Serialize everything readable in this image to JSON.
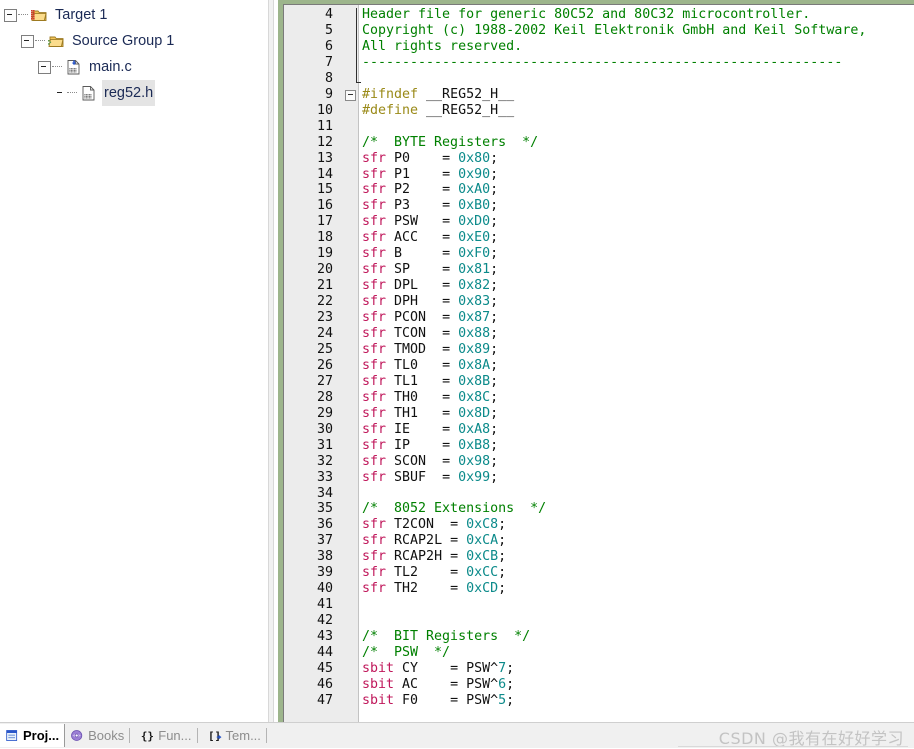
{
  "project_panel": {
    "name": "project-workspace",
    "tree": [
      {
        "label": "Target 1",
        "depth": 0,
        "icon": "target-folder-icon",
        "expander": "collapse",
        "selected": false
      },
      {
        "label": "Source Group 1",
        "depth": 1,
        "icon": "source-group-folder-icon",
        "expander": "collapse",
        "selected": false
      },
      {
        "label": "main.c",
        "depth": 2,
        "icon": "c-source-file-icon",
        "expander": "collapse",
        "selected": false
      },
      {
        "label": "reg52.h",
        "depth": 3,
        "icon": "header-file-icon",
        "expander": "none",
        "selected": true
      }
    ]
  },
  "editor": {
    "name": "source-editor",
    "filename": "reg52.h",
    "first_line": 4,
    "lines": [
      {
        "n": 4,
        "tokens": [
          {
            "t": "Header file for generic 80C52 and 80C32 microcontroller.",
            "c": "cm"
          }
        ],
        "bar": true
      },
      {
        "n": 5,
        "tokens": [
          {
            "t": "Copyright (c) 1988-2002 Keil Elektronik GmbH and Keil Software,",
            "c": "cm"
          }
        ],
        "bar": true
      },
      {
        "n": 6,
        "tokens": [
          {
            "t": "All rights reserved.",
            "c": "cm"
          }
        ],
        "bar": true
      },
      {
        "n": 7,
        "tokens": [
          {
            "t": "------------------------------------------------------------",
            "c": "cm"
          }
        ],
        "bar": true
      },
      {
        "n": 8,
        "tokens": [],
        "bar": true,
        "barfoot": true
      },
      {
        "n": 9,
        "tokens": [
          {
            "t": "#ifndef ",
            "c": "pp"
          },
          {
            "t": "__REG52_H__",
            "c": "pl"
          }
        ],
        "fold": true
      },
      {
        "n": 10,
        "tokens": [
          {
            "t": "#define ",
            "c": "pp"
          },
          {
            "t": "__REG52_H__",
            "c": "pl"
          }
        ]
      },
      {
        "n": 11,
        "tokens": []
      },
      {
        "n": 12,
        "tokens": [
          {
            "t": "/*  BYTE Registers  */",
            "c": "cm"
          }
        ]
      },
      {
        "n": 13,
        "tokens": [
          {
            "t": "sfr",
            "c": "kw"
          },
          {
            "t": " P0    = ",
            "c": "pl"
          },
          {
            "t": "0x80",
            "c": "num"
          },
          {
            "t": ";",
            "c": "pl"
          }
        ]
      },
      {
        "n": 14,
        "tokens": [
          {
            "t": "sfr",
            "c": "kw"
          },
          {
            "t": " P1    = ",
            "c": "pl"
          },
          {
            "t": "0x90",
            "c": "num"
          },
          {
            "t": ";",
            "c": "pl"
          }
        ]
      },
      {
        "n": 15,
        "tokens": [
          {
            "t": "sfr",
            "c": "kw"
          },
          {
            "t": " P2    = ",
            "c": "pl"
          },
          {
            "t": "0xA0",
            "c": "num"
          },
          {
            "t": ";",
            "c": "pl"
          }
        ]
      },
      {
        "n": 16,
        "tokens": [
          {
            "t": "sfr",
            "c": "kw"
          },
          {
            "t": " P3    = ",
            "c": "pl"
          },
          {
            "t": "0xB0",
            "c": "num"
          },
          {
            "t": ";",
            "c": "pl"
          }
        ]
      },
      {
        "n": 17,
        "tokens": [
          {
            "t": "sfr",
            "c": "kw"
          },
          {
            "t": " PSW   = ",
            "c": "pl"
          },
          {
            "t": "0xD0",
            "c": "num"
          },
          {
            "t": ";",
            "c": "pl"
          }
        ]
      },
      {
        "n": 18,
        "tokens": [
          {
            "t": "sfr",
            "c": "kw"
          },
          {
            "t": " ACC   = ",
            "c": "pl"
          },
          {
            "t": "0xE0",
            "c": "num"
          },
          {
            "t": ";",
            "c": "pl"
          }
        ]
      },
      {
        "n": 19,
        "tokens": [
          {
            "t": "sfr",
            "c": "kw"
          },
          {
            "t": " B     = ",
            "c": "pl"
          },
          {
            "t": "0xF0",
            "c": "num"
          },
          {
            "t": ";",
            "c": "pl"
          }
        ]
      },
      {
        "n": 20,
        "tokens": [
          {
            "t": "sfr",
            "c": "kw"
          },
          {
            "t": " SP    = ",
            "c": "pl"
          },
          {
            "t": "0x81",
            "c": "num"
          },
          {
            "t": ";",
            "c": "pl"
          }
        ]
      },
      {
        "n": 21,
        "tokens": [
          {
            "t": "sfr",
            "c": "kw"
          },
          {
            "t": " DPL   = ",
            "c": "pl"
          },
          {
            "t": "0x82",
            "c": "num"
          },
          {
            "t": ";",
            "c": "pl"
          }
        ]
      },
      {
        "n": 22,
        "tokens": [
          {
            "t": "sfr",
            "c": "kw"
          },
          {
            "t": " DPH   = ",
            "c": "pl"
          },
          {
            "t": "0x83",
            "c": "num"
          },
          {
            "t": ";",
            "c": "pl"
          }
        ]
      },
      {
        "n": 23,
        "tokens": [
          {
            "t": "sfr",
            "c": "kw"
          },
          {
            "t": " PCON  = ",
            "c": "pl"
          },
          {
            "t": "0x87",
            "c": "num"
          },
          {
            "t": ";",
            "c": "pl"
          }
        ]
      },
      {
        "n": 24,
        "tokens": [
          {
            "t": "sfr",
            "c": "kw"
          },
          {
            "t": " TCON  = ",
            "c": "pl"
          },
          {
            "t": "0x88",
            "c": "num"
          },
          {
            "t": ";",
            "c": "pl"
          }
        ]
      },
      {
        "n": 25,
        "tokens": [
          {
            "t": "sfr",
            "c": "kw"
          },
          {
            "t": " TMOD  = ",
            "c": "pl"
          },
          {
            "t": "0x89",
            "c": "num"
          },
          {
            "t": ";",
            "c": "pl"
          }
        ]
      },
      {
        "n": 26,
        "tokens": [
          {
            "t": "sfr",
            "c": "kw"
          },
          {
            "t": " TL0   = ",
            "c": "pl"
          },
          {
            "t": "0x8A",
            "c": "num"
          },
          {
            "t": ";",
            "c": "pl"
          }
        ]
      },
      {
        "n": 27,
        "tokens": [
          {
            "t": "sfr",
            "c": "kw"
          },
          {
            "t": " TL1   = ",
            "c": "pl"
          },
          {
            "t": "0x8B",
            "c": "num"
          },
          {
            "t": ";",
            "c": "pl"
          }
        ]
      },
      {
        "n": 28,
        "tokens": [
          {
            "t": "sfr",
            "c": "kw"
          },
          {
            "t": " TH0   = ",
            "c": "pl"
          },
          {
            "t": "0x8C",
            "c": "num"
          },
          {
            "t": ";",
            "c": "pl"
          }
        ]
      },
      {
        "n": 29,
        "tokens": [
          {
            "t": "sfr",
            "c": "kw"
          },
          {
            "t": " TH1   = ",
            "c": "pl"
          },
          {
            "t": "0x8D",
            "c": "num"
          },
          {
            "t": ";",
            "c": "pl"
          }
        ]
      },
      {
        "n": 30,
        "tokens": [
          {
            "t": "sfr",
            "c": "kw"
          },
          {
            "t": " IE    = ",
            "c": "pl"
          },
          {
            "t": "0xA8",
            "c": "num"
          },
          {
            "t": ";",
            "c": "pl"
          }
        ]
      },
      {
        "n": 31,
        "tokens": [
          {
            "t": "sfr",
            "c": "kw"
          },
          {
            "t": " IP    = ",
            "c": "pl"
          },
          {
            "t": "0xB8",
            "c": "num"
          },
          {
            "t": ";",
            "c": "pl"
          }
        ]
      },
      {
        "n": 32,
        "tokens": [
          {
            "t": "sfr",
            "c": "kw"
          },
          {
            "t": " SCON  = ",
            "c": "pl"
          },
          {
            "t": "0x98",
            "c": "num"
          },
          {
            "t": ";",
            "c": "pl"
          }
        ]
      },
      {
        "n": 33,
        "tokens": [
          {
            "t": "sfr",
            "c": "kw"
          },
          {
            "t": " SBUF  = ",
            "c": "pl"
          },
          {
            "t": "0x99",
            "c": "num"
          },
          {
            "t": ";",
            "c": "pl"
          }
        ]
      },
      {
        "n": 34,
        "tokens": []
      },
      {
        "n": 35,
        "tokens": [
          {
            "t": "/*  8052 Extensions  */",
            "c": "cm"
          }
        ]
      },
      {
        "n": 36,
        "tokens": [
          {
            "t": "sfr",
            "c": "kw"
          },
          {
            "t": " T2CON  = ",
            "c": "pl"
          },
          {
            "t": "0xC8",
            "c": "num"
          },
          {
            "t": ";",
            "c": "pl"
          }
        ]
      },
      {
        "n": 37,
        "tokens": [
          {
            "t": "sfr",
            "c": "kw"
          },
          {
            "t": " RCAP2L = ",
            "c": "pl"
          },
          {
            "t": "0xCA",
            "c": "num"
          },
          {
            "t": ";",
            "c": "pl"
          }
        ]
      },
      {
        "n": 38,
        "tokens": [
          {
            "t": "sfr",
            "c": "kw"
          },
          {
            "t": " RCAP2H = ",
            "c": "pl"
          },
          {
            "t": "0xCB",
            "c": "num"
          },
          {
            "t": ";",
            "c": "pl"
          }
        ]
      },
      {
        "n": 39,
        "tokens": [
          {
            "t": "sfr",
            "c": "kw"
          },
          {
            "t": " TL2    = ",
            "c": "pl"
          },
          {
            "t": "0xCC",
            "c": "num"
          },
          {
            "t": ";",
            "c": "pl"
          }
        ]
      },
      {
        "n": 40,
        "tokens": [
          {
            "t": "sfr",
            "c": "kw"
          },
          {
            "t": " TH2    = ",
            "c": "pl"
          },
          {
            "t": "0xCD",
            "c": "num"
          },
          {
            "t": ";",
            "c": "pl"
          }
        ]
      },
      {
        "n": 41,
        "tokens": []
      },
      {
        "n": 42,
        "tokens": []
      },
      {
        "n": 43,
        "tokens": [
          {
            "t": "/*  BIT Registers  */",
            "c": "cm"
          }
        ]
      },
      {
        "n": 44,
        "tokens": [
          {
            "t": "/*  PSW  */",
            "c": "cm"
          }
        ]
      },
      {
        "n": 45,
        "tokens": [
          {
            "t": "sbit",
            "c": "kw"
          },
          {
            "t": " CY    = PSW^",
            "c": "pl"
          },
          {
            "t": "7",
            "c": "num"
          },
          {
            "t": ";",
            "c": "pl"
          }
        ]
      },
      {
        "n": 46,
        "tokens": [
          {
            "t": "sbit",
            "c": "kw"
          },
          {
            "t": " AC    = PSW^",
            "c": "pl"
          },
          {
            "t": "6",
            "c": "num"
          },
          {
            "t": ";",
            "c": "pl"
          }
        ]
      },
      {
        "n": 47,
        "tokens": [
          {
            "t": "sbit",
            "c": "kw"
          },
          {
            "t": " F0    = PSW^",
            "c": "pl"
          },
          {
            "t": "5",
            "c": "num"
          },
          {
            "t": ";",
            "c": "pl"
          }
        ]
      }
    ]
  },
  "bottom_bar": {
    "name": "view-tab-bar",
    "tabs": [
      {
        "label": "Proj...",
        "icon": "project-window-icon",
        "active": true
      },
      {
        "label": "Books",
        "icon": "books-window-icon",
        "active": false
      },
      {
        "label": "Fun...",
        "icon": "functions-brace-icon",
        "active": false
      },
      {
        "label": "Tem...",
        "icon": "templates-icon",
        "active": false
      }
    ],
    "watermark": "CSDN @我有在好好学习"
  },
  "colors": {
    "comment": "#008000",
    "keyword": "#c0185b",
    "number": "#0b8a8a",
    "preprocessor": "#9a8a18",
    "gutter_bg": "#ececec",
    "editor_border": "#9db58c",
    "tree_text": "#1b2a55",
    "selection_bg": "#e4e4e4"
  }
}
